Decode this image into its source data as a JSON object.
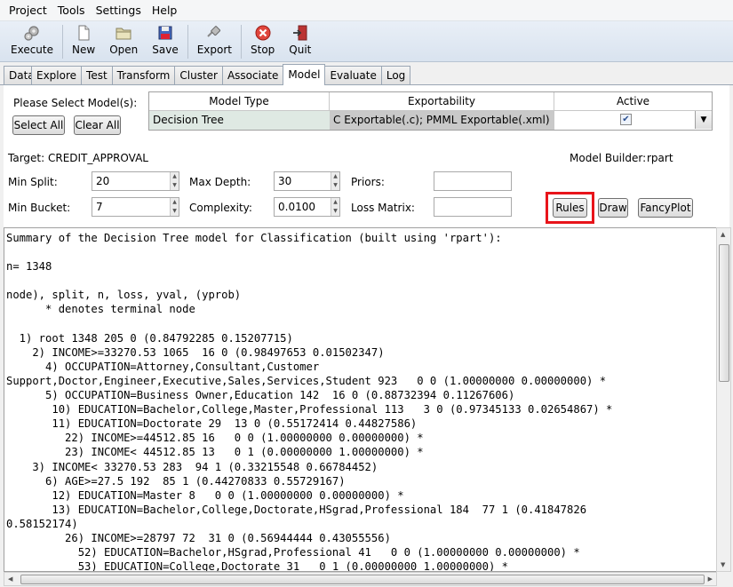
{
  "menu": [
    "Project",
    "Tools",
    "Settings",
    "Help"
  ],
  "toolbar": [
    {
      "label": "Execute",
      "icon": "gears-icon"
    },
    {
      "label": "New",
      "icon": "new-document-icon"
    },
    {
      "label": "Open",
      "icon": "open-folder-icon"
    },
    {
      "label": "Save",
      "icon": "floppy-disk-icon"
    },
    {
      "label": "Export",
      "icon": "export-plug-icon"
    },
    {
      "label": "Stop",
      "icon": "stop-icon"
    },
    {
      "label": "Quit",
      "icon": "exit-door-icon"
    }
  ],
  "tabs": [
    "Data",
    "Explore",
    "Test",
    "Transform",
    "Cluster",
    "Associate",
    "Model",
    "Evaluate",
    "Log"
  ],
  "active_tab": "Model",
  "model_panel": {
    "select_label": "Please Select Model(s):",
    "select_all": "Select All",
    "clear_all": "Clear All",
    "table": {
      "headers": [
        "Model Type",
        "Exportability",
        "Active"
      ],
      "row": {
        "model_type": "Decision Tree",
        "exportability": "C Exportable(.c); PMML Exportable(.xml)",
        "active": true
      }
    },
    "target": "Target: CREDIT_APPROVAL",
    "model_builder_label": "Model Builder:",
    "model_builder_value": "rpart",
    "params": {
      "min_split_label": "Min Split:",
      "min_split": "20",
      "max_depth_label": "Max Depth:",
      "max_depth": "30",
      "priors_label": "Priors:",
      "min_bucket_label": "Min Bucket:",
      "min_bucket": "7",
      "complexity_label": "Complexity:",
      "complexity": "0.0100",
      "loss_matrix_label": "Loss Matrix:"
    },
    "buttons": {
      "rules": "Rules",
      "draw": "Draw",
      "fancyplot": "FancyPlot"
    }
  },
  "output": {
    "lines": [
      "Summary of the Decision Tree model for Classification (built using 'rpart'):",
      "",
      "n= 1348",
      "",
      "node), split, n, loss, yval, (yprob)",
      "      * denotes terminal node",
      "",
      "  1) root 1348 205 0 (0.84792285 0.15207715)",
      "    2) INCOME>=33270.53 1065  16 0 (0.98497653 0.01502347)",
      "      4) OCCUPATION=Attorney,Consultant,Customer",
      "Support,Doctor,Engineer,Executive,Sales,Services,Student 923   0 0 (1.00000000 0.00000000) *",
      "      5) OCCUPATION=Business Owner,Education 142  16 0 (0.88732394 0.11267606)",
      "       10) EDUCATION=Bachelor,College,Master,Professional 113   3 0 (0.97345133 0.02654867) *",
      "       11) EDUCATION=Doctorate 29  13 0 (0.55172414 0.44827586)",
      "         22) INCOME>=44512.85 16   0 0 (1.00000000 0.00000000) *",
      "         23) INCOME< 44512.85 13   0 1 (0.00000000 1.00000000) *",
      "    3) INCOME< 33270.53 283  94 1 (0.33215548 0.66784452)",
      "      6) AGE>=27.5 192  85 1 (0.44270833 0.55729167)",
      "       12) EDUCATION=Master 8   0 0 (1.00000000 0.00000000) *",
      "       13) EDUCATION=Bachelor,College,Doctorate,HSgrad,Professional 184  77 1 (0.41847826",
      "0.58152174)",
      "         26) INCOME>=28797 72  31 0 (0.56944444 0.43055556)",
      "           52) EDUCATION=Bachelor,HSgrad,Professional 41   0 0 (1.00000000 0.00000000) *",
      "           53) EDUCATION=College,Doctorate 31   0 1 (0.00000000 1.00000000) *"
    ]
  },
  "colors": {
    "highlight": "#e8141a",
    "table_selected": "#dfe9e3",
    "table_gray": "#c9c9c9"
  }
}
